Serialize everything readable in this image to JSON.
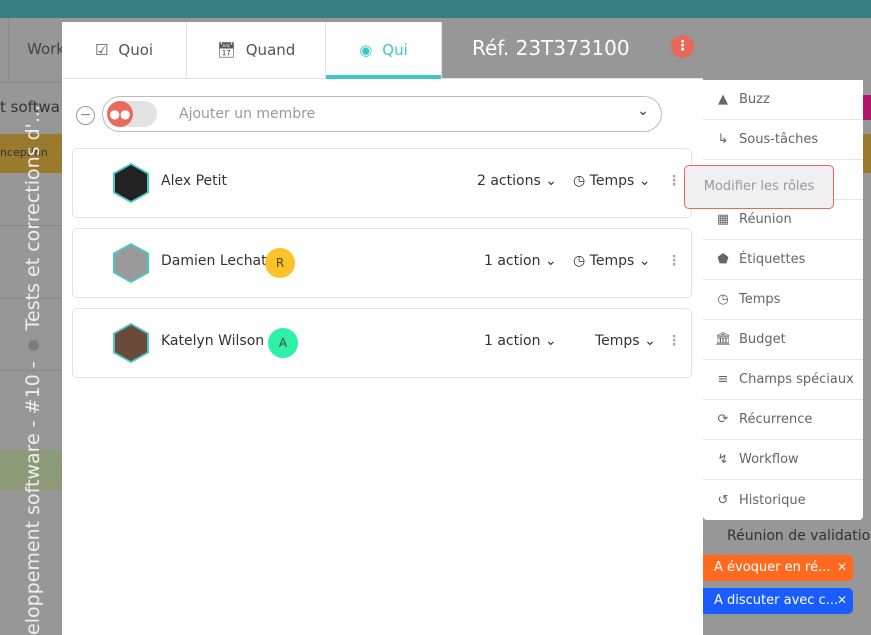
{
  "background": {
    "tab_label": "Work",
    "row_text": "t softwa",
    "gold_row_text": "nception",
    "vertical_title": "eloppement software - #10 -",
    "vertical_title_end": "Tests et corrections d'...",
    "right_meeting": "Réunion de validation",
    "tags": [
      {
        "label": "A évoquer en ré...",
        "color": "#ff6a1f"
      },
      {
        "label": "A discuter avec c...",
        "color": "#1a5cff"
      }
    ]
  },
  "modal": {
    "tabs": [
      {
        "label": "Quoi",
        "icon": "clipboard-check-icon"
      },
      {
        "label": "Quand",
        "icon": "calendar-icon"
      },
      {
        "label": "Qui",
        "icon": "user-circle-icon",
        "active": true
      }
    ],
    "reference": "Réf. 23T373100",
    "accent": "#3cc9c6",
    "add_member": {
      "placeholder": "Ajouter un membre"
    },
    "members": [
      {
        "name": "Alex Petit",
        "role_badge": "",
        "actions": "2 actions",
        "time_label": "Temps",
        "time_icon": true
      },
      {
        "name": "Damien Lechat",
        "role_badge": "R",
        "badge_color": "#fbc327",
        "actions": "1 action",
        "time_label": "Temps",
        "time_icon": true
      },
      {
        "name": "Katelyn Wilson",
        "role_badge": "A",
        "badge_color": "#2ef0a9",
        "actions": "1 action",
        "time_label": "Temps",
        "time_icon": false
      }
    ]
  },
  "side_menu": {
    "items": [
      {
        "label": "Buzz",
        "icon": "bell-icon"
      },
      {
        "label": "Sous-tâches",
        "icon": "subtask-arrow-icon"
      },
      {
        "label": "",
        "icon": ""
      },
      {
        "label": "Réunion",
        "icon": "calendar-icon"
      },
      {
        "label": "Étiquettes",
        "icon": "tag-icon"
      },
      {
        "label": "Temps",
        "icon": "clock-icon"
      },
      {
        "label": "Budget",
        "icon": "bank-icon"
      },
      {
        "label": "Champs spéciaux",
        "icon": "list-icon"
      },
      {
        "label": "Récurrence",
        "icon": "recurrence-icon"
      },
      {
        "label": "Workflow",
        "icon": "workflow-icon"
      },
      {
        "label": "Historique",
        "icon": "history-icon"
      }
    ]
  },
  "tooltip": {
    "label": "Modifier les rôles"
  }
}
